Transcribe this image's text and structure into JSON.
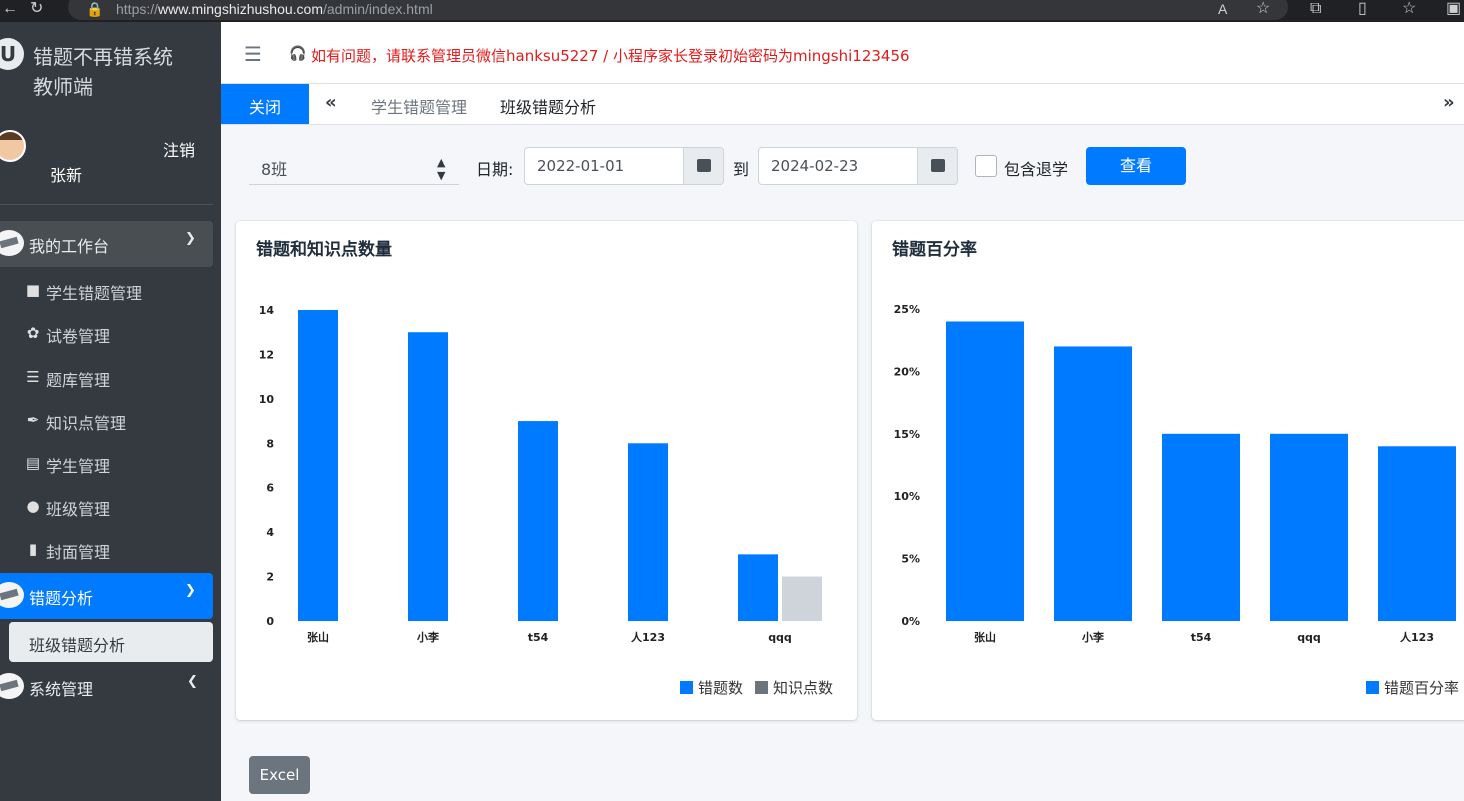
{
  "browser": {
    "url_prefix": "https://",
    "url_host": "www.mingshizhushou.com",
    "url_path": "/admin/index.html"
  },
  "sidebar": {
    "brand_line1": "错题不再错系统",
    "brand_line2": "教师端",
    "user_name": "张新",
    "logout": "注销",
    "workbench": "我的工作台",
    "items": [
      {
        "label": "学生错题管理",
        "icon": "square-icon"
      },
      {
        "label": "试卷管理",
        "icon": "lotus-icon"
      },
      {
        "label": "题库管理",
        "icon": "list-icon"
      },
      {
        "label": "知识点管理",
        "icon": "pen-icon"
      },
      {
        "label": "学生管理",
        "icon": "id-card-icon"
      },
      {
        "label": "班级管理",
        "icon": "comments-icon"
      },
      {
        "label": "封面管理",
        "icon": "file-icon"
      }
    ],
    "error_analysis": "错题分析",
    "class_error_analysis": "班级错题分析",
    "system_management": "系统管理"
  },
  "header": {
    "notice": "如有问题，请联系管理员微信hanksu5227 / 小程序家长登录初始密码为mingshi123456"
  },
  "tabs": {
    "close": "关闭",
    "items": [
      "学生错题管理",
      "班级错题分析"
    ]
  },
  "filters": {
    "class_value": "8班",
    "date_label": "日期:",
    "start_date": "2022-01-01",
    "to_label": "到",
    "end_date": "2024-02-23",
    "include_dropout": "包含退学",
    "view_button": "查看"
  },
  "excel_button": "Excel",
  "colors": {
    "primary": "#007bff",
    "secondary": "#ced4da",
    "legend_secondary": "#6c757d"
  },
  "chart_data": [
    {
      "type": "bar",
      "title": "错题和知识点数量",
      "categories": [
        "张山",
        "小李",
        "t54",
        "人123",
        "qqq"
      ],
      "series": [
        {
          "name": "错题数",
          "values": [
            14,
            13,
            9,
            8,
            3
          ]
        },
        {
          "name": "知识点数",
          "values": [
            0,
            0,
            0,
            0,
            2
          ]
        }
      ],
      "yticks": [
        "0",
        "2",
        "4",
        "6",
        "8",
        "10",
        "12",
        "14"
      ],
      "ylim": [
        0,
        14
      ],
      "legend": "bottom-right"
    },
    {
      "type": "bar",
      "title": "错题百分率",
      "categories": [
        "张山",
        "小李",
        "t54",
        "qqq",
        "人123"
      ],
      "series": [
        {
          "name": "错题百分率",
          "values": [
            24,
            22,
            15,
            15,
            14
          ]
        }
      ],
      "yticks": [
        "0%",
        "5%",
        "10%",
        "15%",
        "20%",
        "25%"
      ],
      "ylim": [
        0,
        25
      ],
      "legend": "bottom-right"
    }
  ]
}
